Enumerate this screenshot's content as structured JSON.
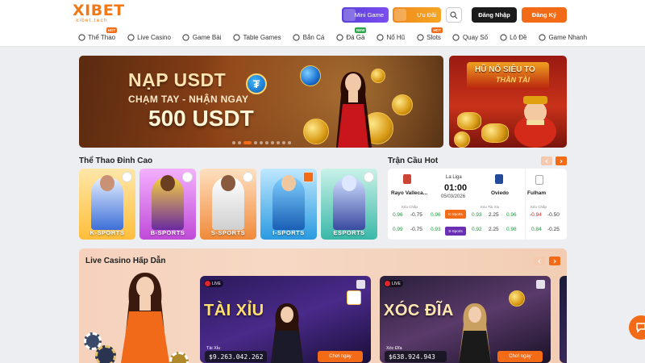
{
  "brand": {
    "logo": "IBET",
    "logo_x": "X",
    "domain": "xibet.tech"
  },
  "header": {
    "mini_game_label": "Mini Game",
    "uu_dai_label": "Ưu Đãi",
    "login_label": "Đăng Nhập",
    "register_label": "Đăng Ký"
  },
  "nav": [
    {
      "label": "Thể Thao",
      "badge": "HOT",
      "icon": "soccer-ball-icon"
    },
    {
      "label": "Live Casino",
      "badge": "",
      "icon": "live-dealer-icon"
    },
    {
      "label": "Game Bài",
      "badge": "",
      "icon": "cards-icon"
    },
    {
      "label": "Table Games",
      "badge": "",
      "icon": "table-icon"
    },
    {
      "label": "Bắn Cá",
      "badge": "",
      "icon": "fish-icon"
    },
    {
      "label": "Đá Gà",
      "badge": "NEW",
      "icon": "rooster-icon"
    },
    {
      "label": "Nổ Hũ",
      "badge": "",
      "icon": "jackpot-icon"
    },
    {
      "label": "Slots",
      "badge": "HOT",
      "icon": "slots-icon"
    },
    {
      "label": "Quay Số",
      "badge": "",
      "icon": "lottery-ball-icon"
    },
    {
      "label": "Lô Đề",
      "badge": "",
      "icon": "link-icon"
    },
    {
      "label": "Game Nhanh",
      "badge": "",
      "icon": "rocket-icon"
    }
  ],
  "banner": {
    "line1": "NẠP USDT",
    "line2": "CHẠM TAY - NHẬN NGAY",
    "line3": "500 USDT"
  },
  "banner2": {
    "title": "HŨ NỔ SIÊU TO",
    "subtitle": "THẦN TÀI"
  },
  "sports": {
    "title": "Thể Thao Đỉnh Cao",
    "cards": [
      {
        "label": "K-SPORTS"
      },
      {
        "label": "B-SPORTS"
      },
      {
        "label": "S-SPORTS"
      },
      {
        "label": "I-SPORTS"
      },
      {
        "label": "ESPORTS"
      }
    ]
  },
  "hot_matches": {
    "title": "Trận Cầu Hot",
    "match": {
      "league": "La Liga",
      "home": "Rayo Valleca...",
      "away": "Oviedo",
      "time": "01:00",
      "date": "05/03/2026",
      "handicap_header": "Kèo Chấp",
      "overunder_header": "Kèo Tài Xỉu",
      "row1": {
        "h1": "0.96",
        "h2": "-0.75",
        "h3": "0.96",
        "src": "K-Sports",
        "o1": "0.93",
        "o2": "2.25",
        "o3": "0.96"
      },
      "row2": {
        "h1": "0.99",
        "h2": "-0.75",
        "h3": "0.93",
        "src": "S-Sports",
        "o1": "0.92",
        "o2": "2.25",
        "o3": "0.98"
      }
    },
    "next_match": {
      "team": "Fulham",
      "header": "Kèo Chấp",
      "row1": {
        "h1": "-0.94",
        "h2": "-0.50"
      },
      "row2": {
        "h1": "0.84",
        "h2": "-0.25"
      }
    }
  },
  "live_casino": {
    "title": "Live Casino Hấp Dẫn",
    "live_label": "LIVE",
    "games": [
      {
        "title": "TÀI XỈU",
        "name": "Tài Xỉu",
        "jackpot": "$9.263.042.262",
        "play_label": "Chơi ngay"
      },
      {
        "title": "XÓC ĐĨA",
        "name": "Xóc Đĩa",
        "jackpot": "$638.924.943",
        "play_label": "Chơi ngay"
      }
    ]
  },
  "colors": {
    "accent": "#f36a17",
    "dark": "#1b1b1b",
    "odd_green": "#1a9a3a",
    "odd_red": "#d22222",
    "purple": "#6b2fb5"
  }
}
